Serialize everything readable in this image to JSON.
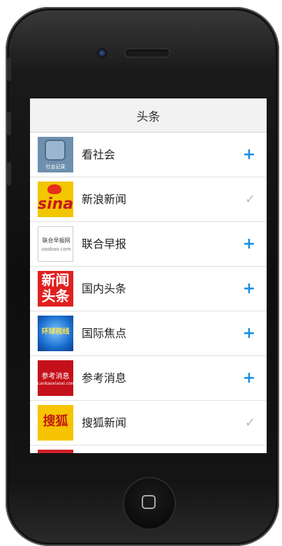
{
  "header": {
    "title": "头条"
  },
  "items": [
    {
      "label": "看社会",
      "logo_text": "社会记录",
      "action": "+",
      "subscribed": false
    },
    {
      "label": "新浪新闻",
      "logo_text": "sina",
      "action": "✓",
      "subscribed": true
    },
    {
      "label": "联合早报",
      "logo_text": "联合早报网",
      "logo_sub": "zaobao.com",
      "action": "+",
      "subscribed": false
    },
    {
      "label": "国内头条",
      "logo_text_1": "新闻",
      "logo_text_2": "头条",
      "action": "+",
      "subscribed": false
    },
    {
      "label": "国际焦点",
      "logo_text": "环球视线",
      "action": "+",
      "subscribed": false
    },
    {
      "label": "参考消息",
      "logo_text": "参考消息",
      "logo_sub": "cankaoxiaoxi.com",
      "action": "+",
      "subscribed": false
    },
    {
      "label": "搜狐新闻",
      "logo_text": "搜狐",
      "action": "✓",
      "subscribed": true
    }
  ],
  "colors": {
    "accent": "#1a8fe3",
    "check": "#b8b8b8",
    "phone_body": "#0e0e0e"
  },
  "icons": {
    "add": "plus-icon",
    "subscribed": "check-icon"
  }
}
